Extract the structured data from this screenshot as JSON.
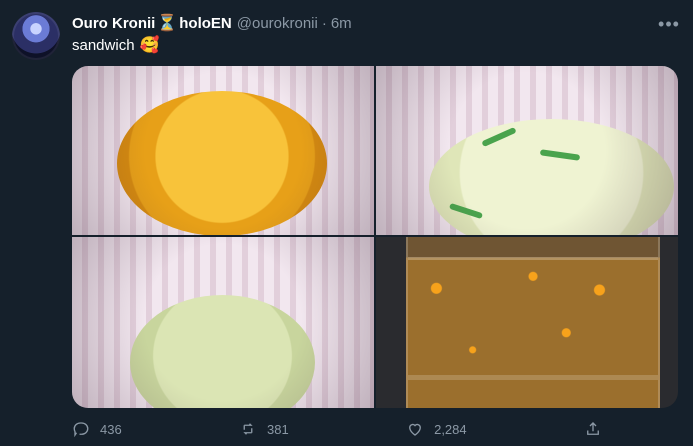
{
  "tweet": {
    "author": {
      "name": "Ouro Kronii",
      "suffix": "holoEN",
      "handle": "@ourokronii",
      "time": "6m",
      "hourglass": "⏳"
    },
    "text": "sandwich",
    "emoji": "🥰",
    "images": [
      {
        "name": "tweet-image-1"
      },
      {
        "name": "tweet-image-2"
      },
      {
        "name": "tweet-image-3"
      },
      {
        "name": "tweet-image-4"
      }
    ],
    "actions": {
      "replies": "436",
      "retweets": "381",
      "likes": "2,284"
    },
    "more": "•••"
  },
  "colors": {
    "background": "#15202b",
    "primary_text": "#ffffff",
    "secondary_text": "#8b98a5"
  },
  "icons": {
    "avatar": "profile-avatar",
    "more": "more-icon",
    "reply": "reply-icon",
    "retweet": "retweet-icon",
    "like": "heart-icon",
    "share": "share-icon"
  }
}
